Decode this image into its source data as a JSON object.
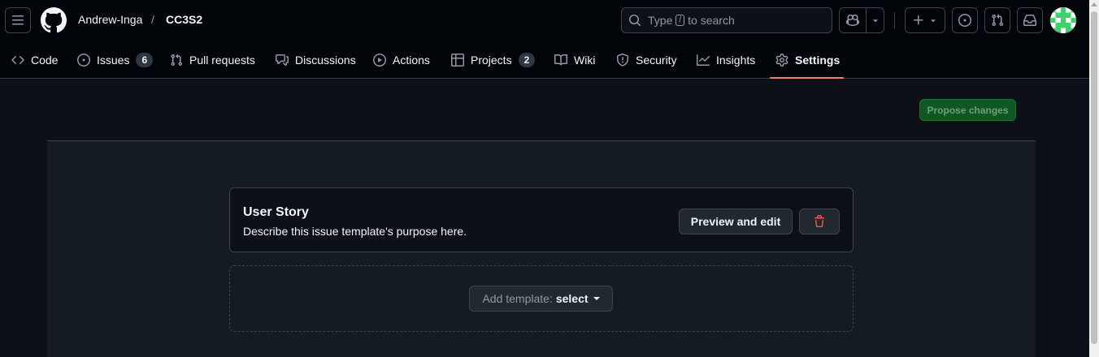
{
  "header": {
    "owner": "Andrew-Inga",
    "separator": "/",
    "repo": "CC3S2",
    "search": {
      "prefix": "Type",
      "key": "/",
      "suffix": "to search"
    }
  },
  "tabs": [
    {
      "label": "Code",
      "icon": "code-icon"
    },
    {
      "label": "Issues",
      "icon": "issue-opened-icon",
      "count": "6"
    },
    {
      "label": "Pull requests",
      "icon": "git-pull-request-icon"
    },
    {
      "label": "Discussions",
      "icon": "comment-discussion-icon"
    },
    {
      "label": "Actions",
      "icon": "play-icon"
    },
    {
      "label": "Projects",
      "icon": "table-icon",
      "count": "2"
    },
    {
      "label": "Wiki",
      "icon": "book-icon"
    },
    {
      "label": "Security",
      "icon": "shield-icon"
    },
    {
      "label": "Insights",
      "icon": "graph-icon"
    },
    {
      "label": "Settings",
      "icon": "gear-icon",
      "active": true
    }
  ],
  "main": {
    "propose_label": "Propose changes",
    "template": {
      "title": "User Story",
      "description": "Describe this issue template's purpose here.",
      "preview_label": "Preview and edit"
    },
    "add_template": {
      "prefix": "Add template:",
      "value": "select"
    }
  },
  "colors": {
    "background": "#010409",
    "panel": "#151b23",
    "accent_underline": "#f78166",
    "propose_green": "#105823",
    "danger": "#f85149"
  }
}
